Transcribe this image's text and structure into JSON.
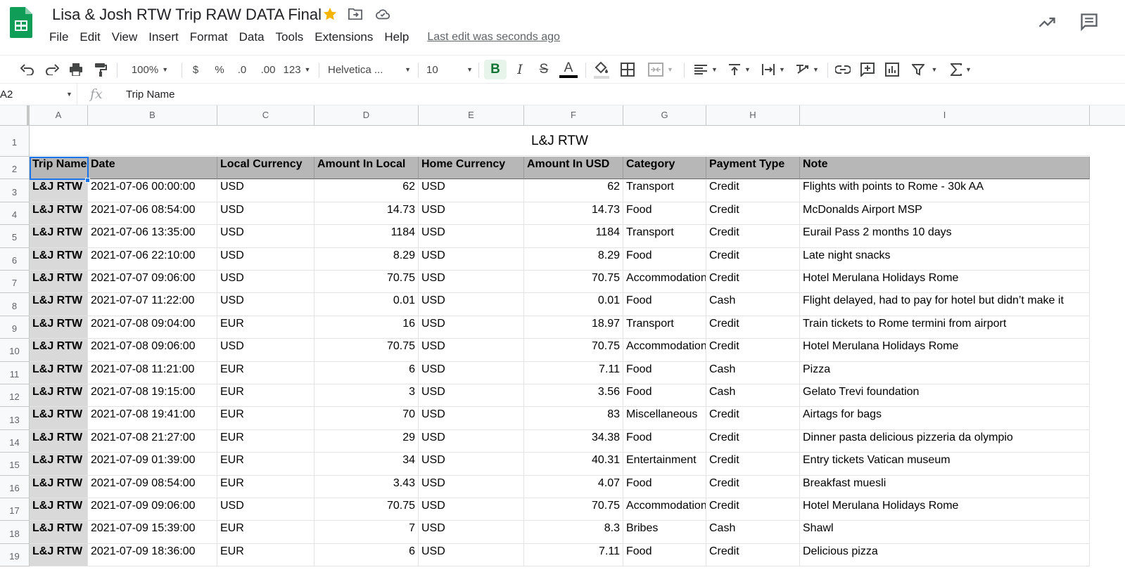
{
  "app": {
    "title": "Lisa & Josh RTW Trip RAW DATA Final",
    "last_edit": "Last edit was seconds ago",
    "menu": [
      "File",
      "Edit",
      "View",
      "Insert",
      "Format",
      "Data",
      "Tools",
      "Extensions",
      "Help"
    ]
  },
  "toolbar": {
    "zoom": "100%",
    "currency": "$",
    "percent": "%",
    "decrease_decimal": ".0",
    "increase_decimal": ".00",
    "number_format": "123",
    "font": "Helvetica ...",
    "font_size": "10",
    "bold": "B",
    "italic": "I",
    "strike": "S",
    "text_color": "A"
  },
  "formula_bar": {
    "name_box": "A2",
    "fx": "fx",
    "value": "Trip Name"
  },
  "colors": {
    "accent": "#1a73e8",
    "header_fill": "#b7b7b7",
    "trip_name_fill": "#d9d9d9",
    "sheets_green": "#0f9d58",
    "star": "#f4b400"
  },
  "sheet": {
    "columns": [
      "A",
      "B",
      "C",
      "D",
      "E",
      "F",
      "G",
      "H",
      "I"
    ],
    "row_numbers": [
      "1",
      "2",
      "3",
      "4",
      "5",
      "6",
      "7",
      "8",
      "9",
      "10",
      "11",
      "12",
      "13",
      "14",
      "15",
      "16",
      "17",
      "18",
      "19"
    ],
    "title": "L&J RTW",
    "headers": [
      "Trip Name",
      "Date",
      "Local Currency",
      "Amount In Local",
      "Home Currency",
      "Amount In USD",
      "Category",
      "Payment Type",
      "Note"
    ],
    "rows": [
      [
        "L&J RTW",
        "2021-07-06 00:00:00",
        "USD",
        "62",
        "USD",
        "62",
        "Transport",
        "Credit",
        "Flights with points to Rome - 30k AA"
      ],
      [
        "L&J RTW",
        "2021-07-06 08:54:00",
        "USD",
        "14.73",
        "USD",
        "14.73",
        "Food",
        "Credit",
        "McDonalds Airport MSP"
      ],
      [
        "L&J RTW",
        "2021-07-06 13:35:00",
        "USD",
        "1184",
        "USD",
        "1184",
        "Transport",
        "Credit",
        "Eurail Pass 2 months 10 days"
      ],
      [
        "L&J RTW",
        "2021-07-06 22:10:00",
        "USD",
        "8.29",
        "USD",
        "8.29",
        "Food",
        "Credit",
        "Late night snacks"
      ],
      [
        "L&J RTW",
        "2021-07-07 09:06:00",
        "USD",
        "70.75",
        "USD",
        "70.75",
        "Accommodation",
        "Credit",
        "Hotel Merulana Holidays Rome"
      ],
      [
        "L&J RTW",
        "2021-07-07 11:22:00",
        "USD",
        "0.01",
        "USD",
        "0.01",
        "Food",
        "Cash",
        "Flight delayed, had to pay for hotel but didn’t make it"
      ],
      [
        "L&J RTW",
        "2021-07-08 09:04:00",
        "EUR",
        "16",
        "USD",
        "18.97",
        "Transport",
        "Credit",
        "Train tickets to Rome termini from airport"
      ],
      [
        "L&J RTW",
        "2021-07-08 09:06:00",
        "USD",
        "70.75",
        "USD",
        "70.75",
        "Accommodation",
        "Credit",
        "Hotel Merulana Holidays Rome"
      ],
      [
        "L&J RTW",
        "2021-07-08 11:21:00",
        "EUR",
        "6",
        "USD",
        "7.11",
        "Food",
        "Cash",
        "Pizza"
      ],
      [
        "L&J RTW",
        "2021-07-08 19:15:00",
        "EUR",
        "3",
        "USD",
        "3.56",
        "Food",
        "Cash",
        "Gelato Trevi foundation"
      ],
      [
        "L&J RTW",
        "2021-07-08 19:41:00",
        "EUR",
        "70",
        "USD",
        "83",
        "Miscellaneous",
        "Credit",
        "Airtags for bags"
      ],
      [
        "L&J RTW",
        "2021-07-08 21:27:00",
        "EUR",
        "29",
        "USD",
        "34.38",
        "Food",
        "Credit",
        "Dinner pasta delicious pizzeria da olympio"
      ],
      [
        "L&J RTW",
        "2021-07-09 01:39:00",
        "EUR",
        "34",
        "USD",
        "40.31",
        "Entertainment",
        "Credit",
        "Entry tickets Vatican museum"
      ],
      [
        "L&J RTW",
        "2021-07-09 08:54:00",
        "EUR",
        "3.43",
        "USD",
        "4.07",
        "Food",
        "Credit",
        "Breakfast muesli"
      ],
      [
        "L&J RTW",
        "2021-07-09 09:06:00",
        "USD",
        "70.75",
        "USD",
        "70.75",
        "Accommodation",
        "Credit",
        "Hotel Merulana Holidays Rome"
      ],
      [
        "L&J RTW",
        "2021-07-09 15:39:00",
        "EUR",
        "7",
        "USD",
        "8.3",
        "Bribes",
        "Cash",
        "Shawl"
      ],
      [
        "L&J RTW",
        "2021-07-09 18:36:00",
        "EUR",
        "6",
        "USD",
        "7.11",
        "Food",
        "Credit",
        "Delicious pizza"
      ]
    ]
  }
}
